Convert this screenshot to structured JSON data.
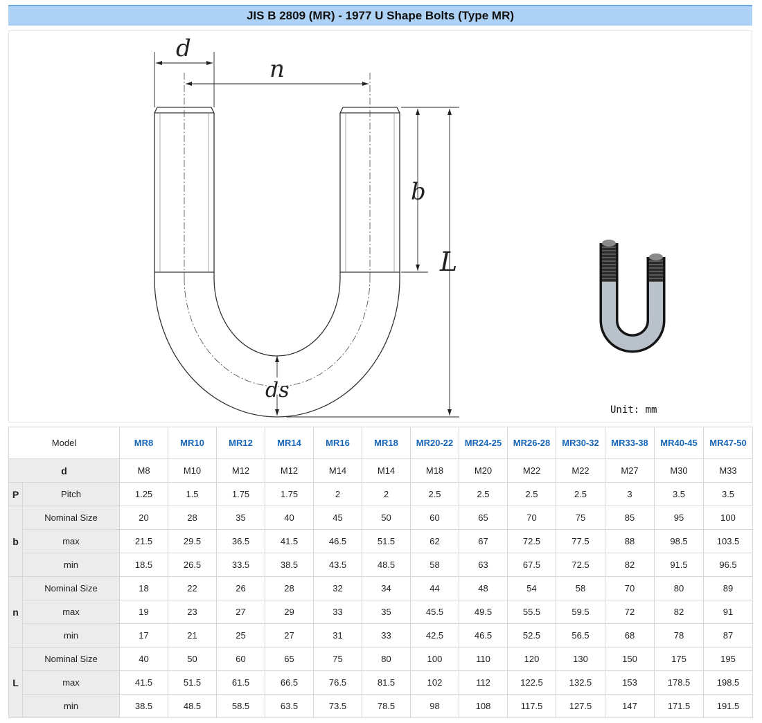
{
  "title": "JIS B 2809 (MR) - 1977 U Shape Bolts (Type MR)",
  "figure": {
    "dim_labels": {
      "d": "d",
      "n": "n",
      "b": "b",
      "L": "L",
      "ds": "ds"
    },
    "unit": "Unit: mm",
    "photo_icon": "u-bolt-photo-icon"
  },
  "table": {
    "model_label": "Model",
    "models": [
      "MR8",
      "MR10",
      "MR12",
      "MR14",
      "MR16",
      "MR18",
      "MR20-22",
      "MR24-25",
      "MR26-28",
      "MR30-32",
      "MR33-38",
      "MR40-45",
      "MR47-50"
    ],
    "d": {
      "label": "d",
      "values": [
        "M8",
        "M10",
        "M12",
        "M12",
        "M14",
        "M14",
        "M18",
        "M20",
        "M22",
        "M22",
        "M27",
        "M30",
        "M33"
      ]
    },
    "p": {
      "group": "P",
      "label": "Pitch",
      "values": [
        "1.25",
        "1.5",
        "1.75",
        "1.75",
        "2",
        "2",
        "2.5",
        "2.5",
        "2.5",
        "2.5",
        "3",
        "3.5",
        "3.5"
      ]
    },
    "b": {
      "group": "b",
      "rows": [
        {
          "label": "Nominal Size",
          "values": [
            "20",
            "28",
            "35",
            "40",
            "45",
            "50",
            "60",
            "65",
            "70",
            "75",
            "85",
            "95",
            "100"
          ]
        },
        {
          "label": "max",
          "values": [
            "21.5",
            "29.5",
            "36.5",
            "41.5",
            "46.5",
            "51.5",
            "62",
            "67",
            "72.5",
            "77.5",
            "88",
            "98.5",
            "103.5"
          ]
        },
        {
          "label": "min",
          "values": [
            "18.5",
            "26.5",
            "33.5",
            "38.5",
            "43.5",
            "48.5",
            "58",
            "63",
            "67.5",
            "72.5",
            "82",
            "91.5",
            "96.5"
          ]
        }
      ]
    },
    "n": {
      "group": "n",
      "rows": [
        {
          "label": "Nominal Size",
          "values": [
            "18",
            "22",
            "26",
            "28",
            "32",
            "34",
            "44",
            "48",
            "54",
            "58",
            "70",
            "80",
            "89"
          ]
        },
        {
          "label": "max",
          "values": [
            "19",
            "23",
            "27",
            "29",
            "33",
            "35",
            "45.5",
            "49.5",
            "55.5",
            "59.5",
            "72",
            "82",
            "91"
          ]
        },
        {
          "label": "min",
          "values": [
            "17",
            "21",
            "25",
            "27",
            "31",
            "33",
            "42.5",
            "46.5",
            "52.5",
            "56.5",
            "68",
            "78",
            "87"
          ]
        }
      ]
    },
    "l": {
      "group": "L",
      "rows": [
        {
          "label": "Nominal Size",
          "values": [
            "40",
            "50",
            "60",
            "65",
            "75",
            "80",
            "100",
            "110",
            "120",
            "130",
            "150",
            "175",
            "195"
          ]
        },
        {
          "label": "max",
          "values": [
            "41.5",
            "51.5",
            "61.5",
            "66.5",
            "76.5",
            "81.5",
            "102",
            "112",
            "122.5",
            "132.5",
            "153",
            "178.5",
            "198.5"
          ]
        },
        {
          "label": "min",
          "values": [
            "38.5",
            "48.5",
            "58.5",
            "63.5",
            "73.5",
            "78.5",
            "98",
            "108",
            "117.5",
            "127.5",
            "147",
            "171.5",
            "191.5"
          ]
        }
      ]
    }
  }
}
